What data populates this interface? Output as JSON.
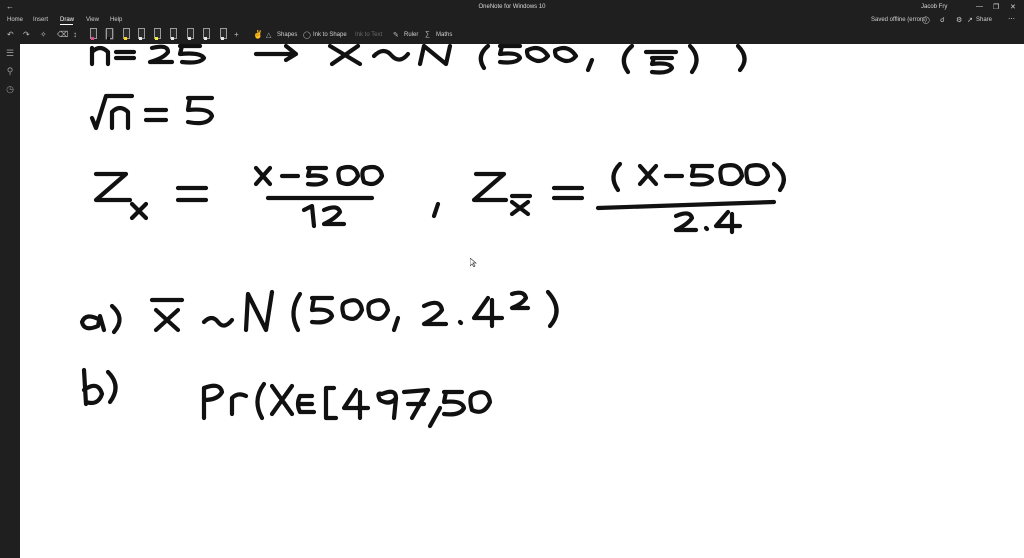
{
  "titlebar": {
    "app_title": "OneNote for Windows 10",
    "user_name": "Jacob Fry",
    "back_icon": "back-arrow-icon"
  },
  "tabs": [
    "Home",
    "Insert",
    "Draw",
    "View",
    "Help"
  ],
  "active_tab": "Draw",
  "status": {
    "saved_text": "Saved offline (errors)",
    "share_label": "Share"
  },
  "toolbar": {
    "shapes_label": "Shapes",
    "ink_to_shape_label": "Ink to Shape",
    "ink_to_text_label": "Ink to Text",
    "ruler_label": "Ruler",
    "maths_label": "Maths",
    "pen_colors": [
      "#e04a8a",
      "#111111",
      "#ffd21f",
      "#e8e8e8",
      "#f3ef3a",
      "#e8e8e8",
      "#e8e8e8",
      "#e8e8e8",
      "#e8e8e8",
      "#e8e8e8",
      "#e8e8e8"
    ]
  },
  "colors": {
    "chrome": "#1f1f1f",
    "page": "#ffffff",
    "ink": "#111111"
  }
}
